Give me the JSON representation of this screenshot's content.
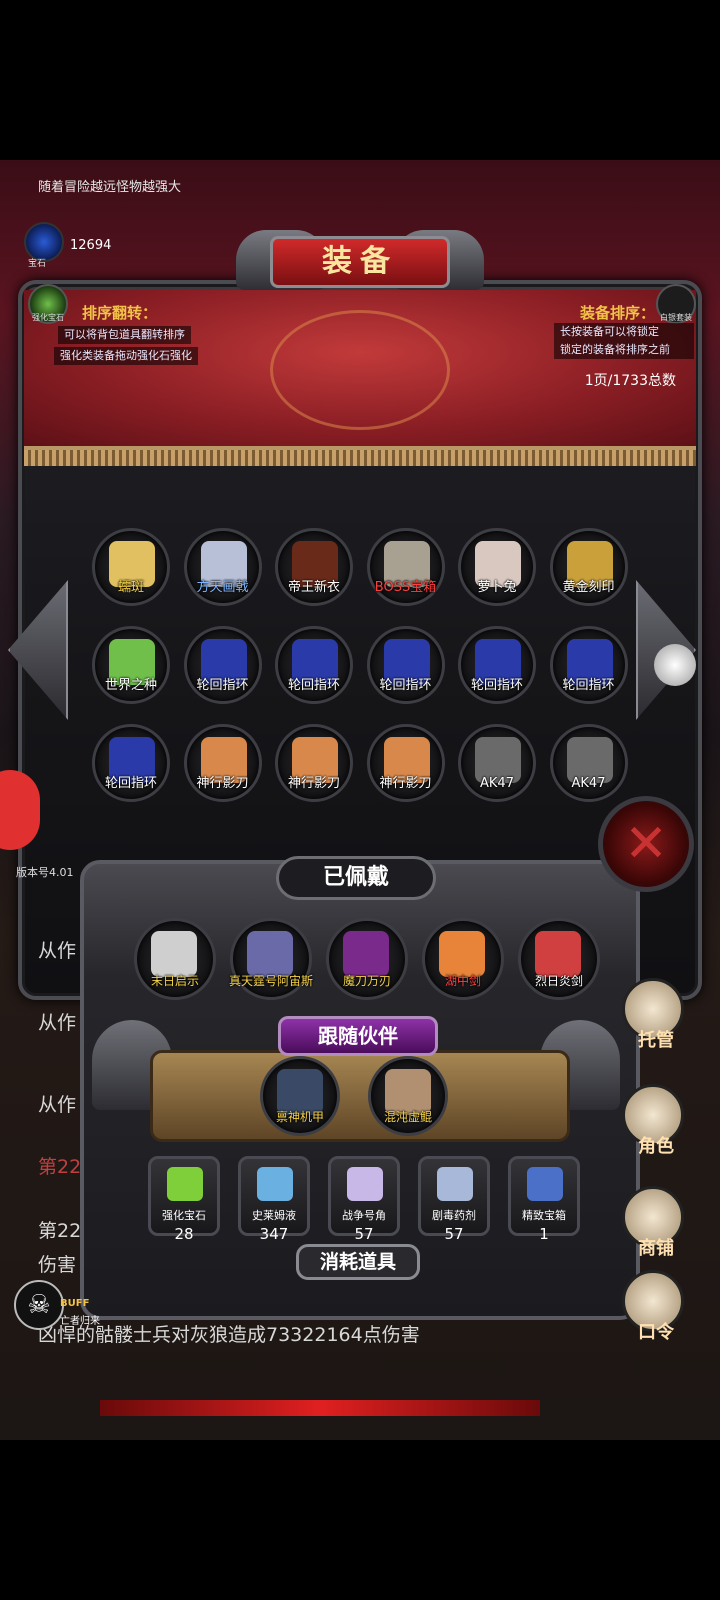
{
  "top_hint": "随着冒险越远怪物越强大",
  "gem": {
    "value": "12694",
    "label": "宝石"
  },
  "title": "装备",
  "left_badge_label": "强化宝石",
  "right_badge_label": "白银套装",
  "sort_left": {
    "title": "排序翻转：",
    "line1": "可以将背包道具翻转排序",
    "line2": "强化类装备拖动强化石强化"
  },
  "sort_right": {
    "title": "装备排序：",
    "line1": "长按装备可以将锁定",
    "line2": "锁定的装备将排序之前"
  },
  "page_info": "1页/1733总数",
  "inventory": [
    {
      "name": "蠕斑",
      "color": "#e0c060",
      "style": "gold"
    },
    {
      "name": "方天画戟",
      "color": "#b8c0d8",
      "style": "blue"
    },
    {
      "name": "帝王新衣",
      "color": "#6a2a1a",
      "style": ""
    },
    {
      "name": "BOSS宝箱",
      "color": "#a8a090",
      "style": "red"
    },
    {
      "name": "萝卜兔",
      "color": "#d8c8c0",
      "style": ""
    },
    {
      "name": "黄金刻印",
      "color": "#c9a03a",
      "style": ""
    },
    {
      "name": "世界之种",
      "color": "#6fbf4a",
      "style": ""
    },
    {
      "name": "轮回指环",
      "color": "#2a3aa8",
      "style": ""
    },
    {
      "name": "轮回指环",
      "color": "#2a3aa8",
      "style": ""
    },
    {
      "name": "轮回指环",
      "color": "#2a3aa8",
      "style": ""
    },
    {
      "name": "轮回指环",
      "color": "#2a3aa8",
      "style": ""
    },
    {
      "name": "轮回指环",
      "color": "#2a3aa8",
      "style": ""
    },
    {
      "name": "轮回指环",
      "color": "#2a3aa8",
      "style": ""
    },
    {
      "name": "神行影刀",
      "color": "#d8884a",
      "style": ""
    },
    {
      "name": "神行影刀",
      "color": "#d8884a",
      "style": ""
    },
    {
      "name": "神行影刀",
      "color": "#d8884a",
      "style": ""
    },
    {
      "name": "AK47",
      "color": "#6a6a6a",
      "style": ""
    },
    {
      "name": "AK47",
      "color": "#6a6a6a",
      "style": ""
    }
  ],
  "close_label": "✕",
  "version": "版本号4.01",
  "worn_title": "已佩戴",
  "worn": [
    {
      "name": "末日启示",
      "color": "#cfcfcf",
      "style": "gold"
    },
    {
      "name": "真天霆号阿宙斯",
      "color": "#6a6aa8",
      "style": "gold"
    },
    {
      "name": "魔刀万刃",
      "color": "#7a2a8a",
      "style": "gold"
    },
    {
      "name": "湖中剑",
      "color": "#e8843a",
      "style": "red"
    },
    {
      "name": "烈日炎剑",
      "color": "#d04040",
      "style": ""
    }
  ],
  "companion_title": "跟随伙伴",
  "companions": [
    {
      "name": "禀神机甲",
      "color": "#3a4a66"
    },
    {
      "name": "混沌虚鲲",
      "color": "#b09070"
    }
  ],
  "consumables": [
    {
      "name": "强化宝石",
      "count": "28",
      "color": "#7fcf3a"
    },
    {
      "name": "史莱姆液",
      "count": "347",
      "color": "#6ab0e0"
    },
    {
      "name": "战争号角",
      "count": "57",
      "color": "#c8b8e8"
    },
    {
      "name": "剧毒药剂",
      "count": "57",
      "color": "#a8b8d8"
    },
    {
      "name": "精致宝箱",
      "count": "1",
      "color": "#4a70c8"
    }
  ],
  "consumables_title": "消耗道具",
  "log": [
    "从作",
    "从作",
    "从作",
    "第22",
    "第22",
    "伤害",
    "凶悍的骷髅士兵对灰狼造成73322164点伤害"
  ],
  "right_menu": [
    "托管",
    "角色",
    "商铺",
    "口令"
  ],
  "buff": {
    "title": "BUFF",
    "sub": "亡者归来"
  }
}
